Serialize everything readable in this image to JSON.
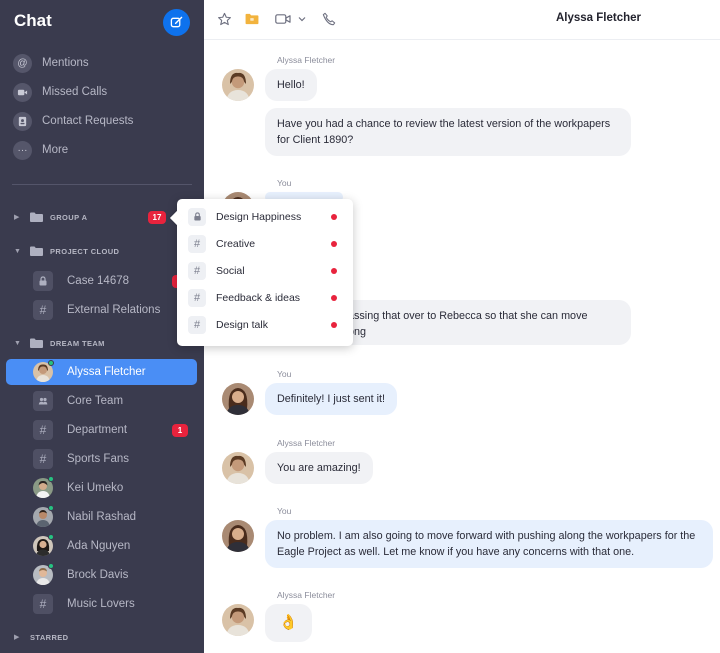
{
  "sidebar": {
    "title": "Chat",
    "quick_links": [
      {
        "label": "Mentions",
        "icon": "at-icon"
      },
      {
        "label": "Missed Calls",
        "icon": "video-camera-icon"
      },
      {
        "label": "Contact Requests",
        "icon": "contact-card-icon"
      },
      {
        "label": "More",
        "icon": "more-dots-icon"
      }
    ],
    "groups": [
      {
        "label": "GROUP A",
        "badge": "17",
        "expanded": false
      },
      {
        "label": "PROJECT CLOUD",
        "expanded": true
      },
      {
        "label": "DREAM TEAM",
        "expanded": true
      },
      {
        "label": "STARRED",
        "expanded": false
      }
    ],
    "items": [
      {
        "label": "Case 14678",
        "icon": "lock-icon"
      },
      {
        "label": "External Relations",
        "icon": "hash-icon"
      },
      {
        "label": "Alyssa Fletcher",
        "icon": "avatar",
        "active": true
      },
      {
        "label": "Core Team",
        "icon": "people-icon"
      },
      {
        "label": "Department",
        "icon": "hash-icon",
        "badge": "1"
      },
      {
        "label": "Sports Fans",
        "icon": "hash-icon"
      },
      {
        "label": "Kei Umeko",
        "icon": "avatar"
      },
      {
        "label": "Nabil Rashad",
        "icon": "avatar"
      },
      {
        "label": "Ada Nguyen",
        "icon": "avatar"
      },
      {
        "label": "Brock Davis",
        "icon": "avatar"
      },
      {
        "label": "Music Lovers",
        "icon": "hash-icon"
      }
    ]
  },
  "header": {
    "title": "Alyssa Fletcher",
    "icons": [
      "star-icon",
      "folder-icon",
      "video-camera-icon",
      "chevron-down-icon",
      "phone-icon"
    ]
  },
  "popover": {
    "items": [
      {
        "label": "Design Happiness",
        "icon": "lock-icon"
      },
      {
        "label": "Creative",
        "icon": "hash-icon"
      },
      {
        "label": "Social",
        "icon": "hash-icon"
      },
      {
        "label": "Feedback & ideas",
        "icon": "hash-icon"
      },
      {
        "label": "Design talk",
        "icon": "hash-icon"
      }
    ]
  },
  "messages": [
    {
      "sender": "Alyssa Fletcher",
      "text": "Hello!"
    },
    {
      "text": "Have you had a chance to review the latest version of the workpapers for Client 1890?"
    },
    {
      "sender": "You"
    },
    {
      "text": "assing that over to Rebecca so that she can move"
    },
    {
      "text": "ong"
    },
    {
      "sender": "You",
      "text": "Definitely! I just sent it!"
    },
    {
      "sender": "Alyssa Fletcher",
      "text": "You are amazing!"
    },
    {
      "sender": "You",
      "text": "No problem. I am also going to move forward with pushing along the workpapers for the Eagle Project as well. Let me know if you have any concerns with that one."
    },
    {
      "sender": "Alyssa Fletcher",
      "text": "👌"
    }
  ],
  "colors": {
    "sidebar_bg": "#3a3b4e",
    "accent": "#0e72ed",
    "active_item": "#4a8ef5",
    "badge": "#e8233d",
    "presence": "#26c281",
    "my_bubble": "#e7f0fd",
    "their_bubble": "#f1f2f5"
  }
}
